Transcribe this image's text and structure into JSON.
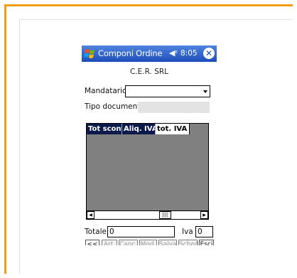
{
  "window": {
    "title": "Componi Ordine",
    "clock": "8:05"
  },
  "company": "C.E.R. SRL",
  "form": {
    "mandatario_label": "Mandatario:",
    "mandatario_value": "",
    "tipo_documento_label": "Tipo documento:",
    "tipo_documento_value": ""
  },
  "grid": {
    "columns": [
      "Tot sconto",
      "Aliq. IVA",
      "tot. IVA"
    ],
    "rows": []
  },
  "totals": {
    "totale_label": "Totale",
    "totale_value": "0",
    "iva_label": "Iva",
    "iva_value": "0"
  },
  "buttons": {
    "back": "<<",
    "art": "Art.",
    "canc": "Canc.",
    "mod": "Mod.",
    "salva": "Salva",
    "sched": "Sched",
    "esci": "Esci"
  },
  "colors": {
    "frame_accent": "#f39c12",
    "titlebar": "#1c4db8",
    "header_dark": "#0c1a4b",
    "grid_bg": "#808080"
  },
  "icons": {
    "start": "windows-flag-icon",
    "speaker": "speaker-icon",
    "close": "close-icon",
    "keyboard": "keyboard-icon"
  }
}
